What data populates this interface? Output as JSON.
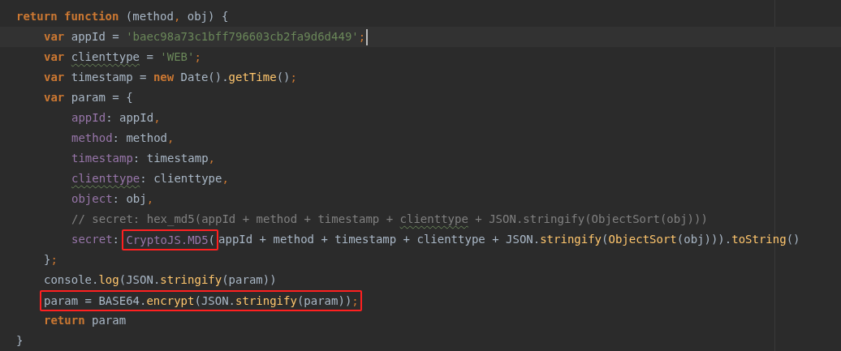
{
  "editor": {
    "lines": [
      {
        "current": false,
        "tokens": [
          {
            "kind": "keyword",
            "text": "return function"
          },
          {
            "kind": "plain",
            "text": " (method"
          },
          {
            "kind": "punct",
            "text": ","
          },
          {
            "kind": "plain",
            "text": " obj) {"
          }
        ],
        "children": [
          {
            "current": true,
            "tokens": [
              {
                "kind": "keyword",
                "text": "var"
              },
              {
                "kind": "plain",
                "text": " appId = "
              },
              {
                "kind": "string",
                "text": "'baec98a73c1bff796603cb2fa9d6d449'"
              },
              {
                "kind": "punct",
                "text": ";"
              }
            ]
          },
          {
            "current": false,
            "tokens": [
              {
                "kind": "keyword",
                "text": "var "
              },
              {
                "kind": "typo",
                "text": "clienttype"
              },
              {
                "kind": "plain",
                "text": " = "
              },
              {
                "kind": "string",
                "text": "'WEB'"
              },
              {
                "kind": "punct",
                "text": ";"
              }
            ]
          },
          {
            "current": false,
            "tokens": [
              {
                "kind": "keyword",
                "text": "var"
              },
              {
                "kind": "plain",
                "text": " timestamp = "
              },
              {
                "kind": "keyword",
                "text": "new"
              },
              {
                "kind": "plain",
                "text": " Date()."
              },
              {
                "kind": "method",
                "text": "getTime"
              },
              {
                "kind": "plain",
                "text": "()"
              },
              {
                "kind": "punct",
                "text": ";"
              }
            ]
          },
          {
            "current": false,
            "tokens": [
              {
                "kind": "keyword",
                "text": "var"
              },
              {
                "kind": "plain",
                "text": " param = {"
              }
            ],
            "children": [
              {
                "current": false,
                "tokens": [
                  {
                    "kind": "property",
                    "text": "appId"
                  },
                  {
                    "kind": "plain",
                    "text": ": appId"
                  },
                  {
                    "kind": "punct",
                    "text": ","
                  }
                ]
              },
              {
                "current": false,
                "tokens": [
                  {
                    "kind": "property",
                    "text": "method"
                  },
                  {
                    "kind": "plain",
                    "text": ": method"
                  },
                  {
                    "kind": "punct",
                    "text": ","
                  }
                ]
              },
              {
                "current": false,
                "tokens": [
                  {
                    "kind": "property",
                    "text": "timestamp"
                  },
                  {
                    "kind": "plain",
                    "text": ": timestamp"
                  },
                  {
                    "kind": "punct",
                    "text": ","
                  }
                ]
              },
              {
                "current": false,
                "tokens": [
                  {
                    "kind": "typoprop",
                    "text": "clienttype"
                  },
                  {
                    "kind": "plain",
                    "text": ": clienttype"
                  },
                  {
                    "kind": "punct",
                    "text": ","
                  }
                ]
              },
              {
                "current": false,
                "tokens": [
                  {
                    "kind": "property",
                    "text": "object"
                  },
                  {
                    "kind": "plain",
                    "text": ": obj"
                  },
                  {
                    "kind": "punct",
                    "text": ","
                  }
                ]
              },
              {
                "current": false,
                "tokens": [
                  {
                    "kind": "comment",
                    "text": "// secret: hex_md5(appId + method + timestamp + "
                  },
                  {
                    "kind": "typocomment",
                    "text": "clienttype"
                  },
                  {
                    "kind": "comment",
                    "text": " + JSON.stringify(ObjectSort(obj)))"
                  }
                ]
              },
              {
                "current": false,
                "tokens": [
                  {
                    "kind": "property",
                    "text": "secret"
                  },
                  {
                    "kind": "plain",
                    "text": ": "
                  },
                  {
                    "kind": "box",
                    "tokens": [
                      {
                        "kind": "property",
                        "text": "CryptoJS.MD5"
                      },
                      {
                        "kind": "plain",
                        "text": "("
                      }
                    ]
                  },
                  {
                    "kind": "plain",
                    "text": "appId + method + timestamp + clienttype + JSON."
                  },
                  {
                    "kind": "method",
                    "text": "stringify"
                  },
                  {
                    "kind": "plain",
                    "text": "("
                  },
                  {
                    "kind": "method",
                    "text": "ObjectSort"
                  },
                  {
                    "kind": "plain",
                    "text": "(obj)))."
                  },
                  {
                    "kind": "method",
                    "text": "toString"
                  },
                  {
                    "kind": "plain",
                    "text": "()"
                  }
                ]
              }
            ]
          },
          {
            "current": false,
            "tokens": [
              {
                "kind": "plain",
                "text": "}"
              },
              {
                "kind": "punct",
                "text": ";"
              }
            ]
          },
          {
            "current": false,
            "tokens": [
              {
                "kind": "plain",
                "text": "console."
              },
              {
                "kind": "method",
                "text": "log"
              },
              {
                "kind": "plain",
                "text": "(JSON."
              },
              {
                "kind": "method",
                "text": "stringify"
              },
              {
                "kind": "plain",
                "text": "(param))"
              }
            ]
          },
          {
            "current": false,
            "tokens": [
              {
                "kind": "box",
                "tokens": [
                  {
                    "kind": "plain",
                    "text": "param = BASE64."
                  },
                  {
                    "kind": "method",
                    "text": "encrypt"
                  },
                  {
                    "kind": "plain",
                    "text": "(JSON."
                  },
                  {
                    "kind": "method",
                    "text": "stringify"
                  },
                  {
                    "kind": "plain",
                    "text": "(param))"
                  },
                  {
                    "kind": "punct",
                    "text": ";"
                  }
                ]
              }
            ]
          },
          {
            "current": false,
            "tokens": [
              {
                "kind": "keyword",
                "text": "return"
              },
              {
                "kind": "plain",
                "text": " param"
              }
            ]
          }
        ]
      },
      {
        "current": false,
        "tokens": [
          {
            "kind": "plain",
            "text": "}"
          }
        ]
      }
    ]
  }
}
